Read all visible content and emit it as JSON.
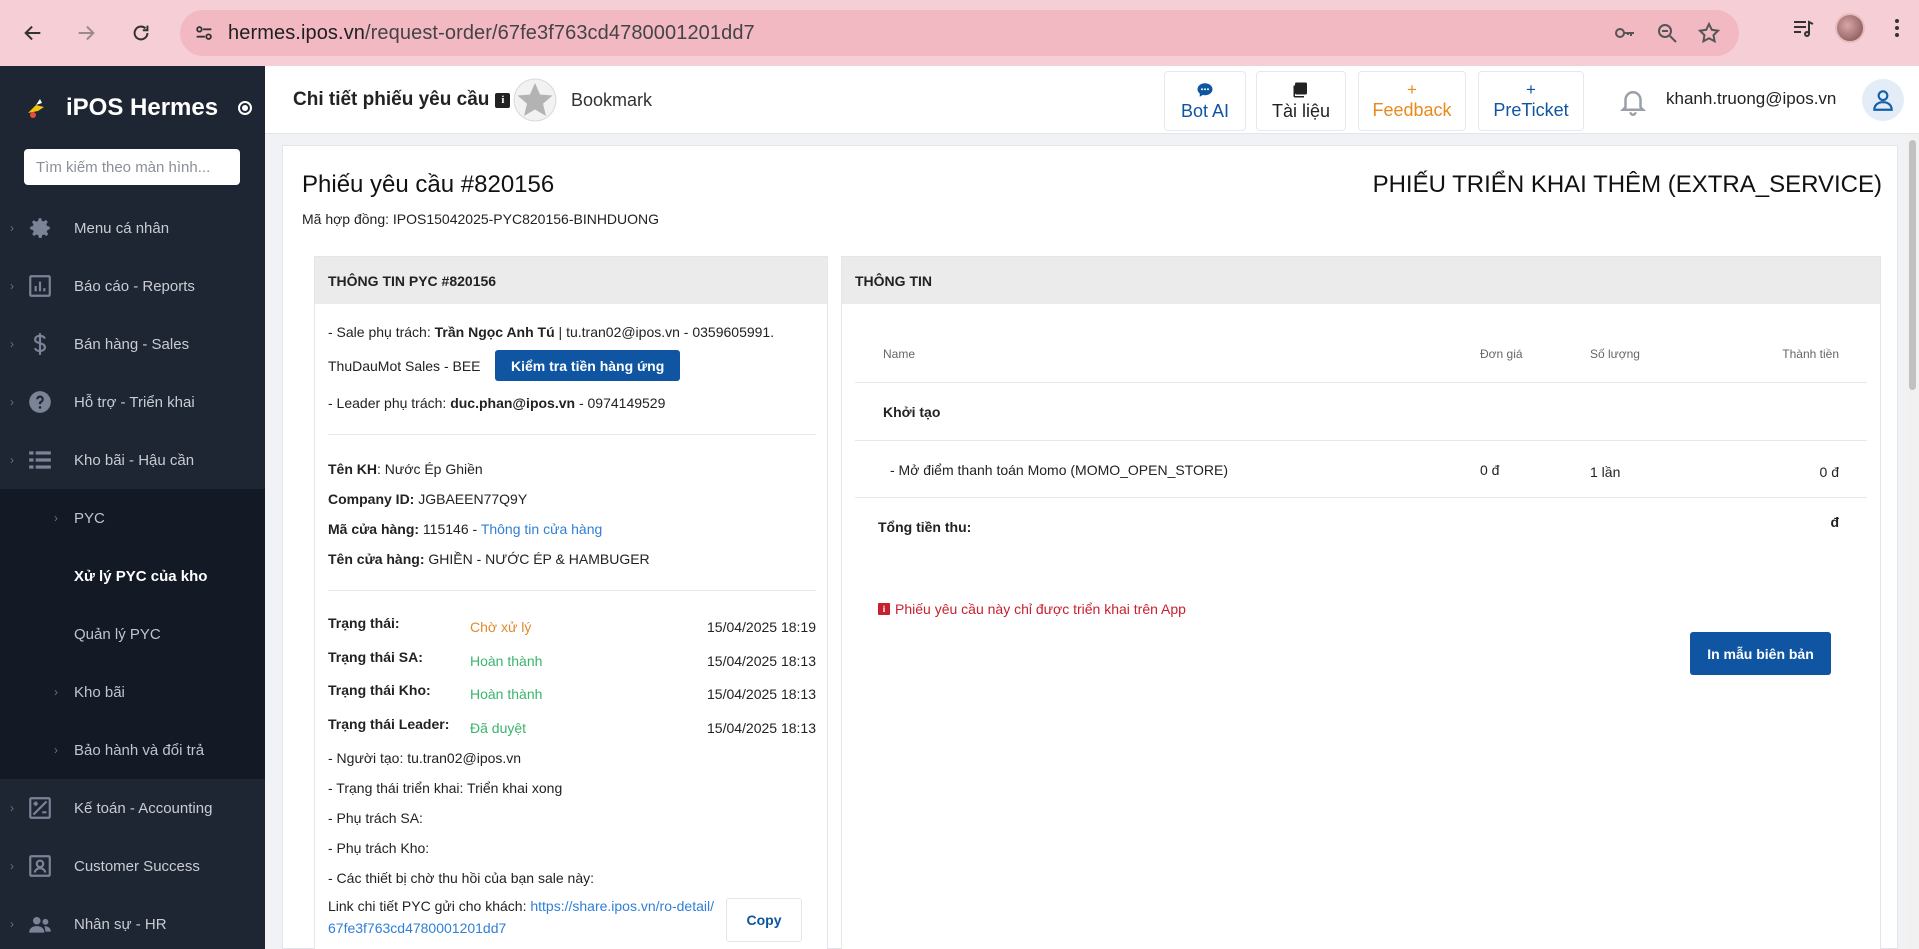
{
  "browser": {
    "url_host": "hermes.ipos.vn",
    "url_path": "/request-order/67fe3f763cd4780001201dd7"
  },
  "sidebar": {
    "brand": "iPOS Hermes",
    "search_placeholder": "Tìm kiếm theo màn hình...",
    "menu": [
      {
        "label": "Menu cá nhân",
        "icon": "gear-icon"
      },
      {
        "label": "Báo cáo - Reports",
        "icon": "report-icon"
      },
      {
        "label": "Bán hàng - Sales",
        "icon": "dollar-icon"
      },
      {
        "label": "Hỗ trợ - Triển khai",
        "icon": "help-icon"
      },
      {
        "label": "Kho bãi - Hậu cần",
        "icon": "list-icon"
      }
    ],
    "submenu": [
      {
        "label": "PYC",
        "has_children": true
      },
      {
        "label": "Xử lý PYC của kho",
        "has_children": false,
        "active": true
      },
      {
        "label": "Quản lý PYC",
        "has_children": false
      },
      {
        "label": "Kho bãi",
        "has_children": true
      },
      {
        "label": "Bảo hành và đổi trả",
        "has_children": true
      }
    ],
    "menu_bottom": [
      {
        "label": "Kế toán - Accounting",
        "icon": "accounting-icon"
      },
      {
        "label": "Customer Success",
        "icon": "customer-icon"
      },
      {
        "label": "Nhân sự - HR",
        "icon": "people-icon"
      }
    ]
  },
  "header": {
    "title": "Chi tiết phiếu yêu cầu",
    "bookmark": "Bookmark",
    "buttons": {
      "bot_ai": "Bot AI",
      "docs": "Tài liệu",
      "feedback": "Feedback",
      "preticket": "PreTicket"
    },
    "user_email": "khanh.truong@ipos.vn"
  },
  "request": {
    "title": "Phiếu yêu cầu #820156",
    "type": "PHIẾU TRIỂN KHAI THÊM (EXTRA_SERVICE)",
    "contract": "Mã hợp đồng: IPOS15042025-PYC820156-BINHDUONG"
  },
  "left_panel": {
    "heading": "THÔNG TIN PYC #820156",
    "sale_prefix": "- Sale phụ trách: ",
    "sale_name": "Trần Ngọc Anh Tú",
    "sale_contact": " | tu.tran02@ipos.vn - 0359605991.",
    "sale_team": "ThuDauMot Sales - BEE",
    "check_button": "Kiểm tra tiền hàng ứng",
    "leader_prefix": "- Leader phụ trách: ",
    "leader_email": "duc.phan@ipos.vn",
    "leader_phone": " - 0974149529",
    "customer_label": "Tên KH",
    "customer_value": ": Nước Ép Ghiền",
    "company_label": "Company ID:",
    "company_value": " JGBAEEN77Q9Y",
    "store_code_label": "Mã cửa hàng:",
    "store_code_value": " 115146 - ",
    "store_info_link": "Thông tin cửa hàng",
    "store_name_label": "Tên cửa hàng:",
    "store_name_value": " GHIỀN - NƯỚC ÉP & HAMBUGER",
    "statuses": [
      {
        "label": "Trạng thái:",
        "value": "Chờ xử lý",
        "color": "#e08a2c",
        "time": "15/04/2025 18:19"
      },
      {
        "label": "Trạng thái SA:",
        "value": "Hoàn thành",
        "color": "#3ab56b",
        "time": "15/04/2025 18:13"
      },
      {
        "label": "Trạng thái Kho:",
        "value": "Hoàn thành",
        "color": "#3ab56b",
        "time": "15/04/2025 18:13"
      },
      {
        "label": "Trạng thái Leader:",
        "value": "Đã duyệt",
        "color": "#3ab56b",
        "time": "15/04/2025 18:13"
      }
    ],
    "creator": "- Người tạo: tu.tran02@ipos.vn",
    "deploy_status": "- Trạng thái triển khai: Triển khai xong",
    "sa_owner": "- Phụ trách SA:",
    "warehouse_owner": "- Phụ trách Kho:",
    "pending_devices": "- Các thiết bị chờ thu hồi của bạn sale này:",
    "link_label": "Link chi tiết PYC gửi cho khách: ",
    "link_line1": "https://share.ipos.vn/ro-detail/",
    "link_line2": "67fe3f763cd4780001201dd7",
    "copy_button": "Copy"
  },
  "right_panel": {
    "heading": "THÔNG TIN",
    "columns": {
      "name": "Name",
      "price": "Đơn giá",
      "qty": "Số lượng",
      "total": "Thành tiền"
    },
    "group": "Khởi tạo",
    "rows": [
      {
        "name": "- Mở điểm thanh toán Momo (MOMO_OPEN_STORE)",
        "price": "0 đ",
        "qty": "1 lần",
        "total": "0 đ"
      }
    ],
    "total_label": "Tổng tiền thu:",
    "total_value": "đ",
    "warning": "Phiếu yêu cầu này chỉ được triển khai trên App",
    "print_button": "In mẫu biên bản"
  }
}
